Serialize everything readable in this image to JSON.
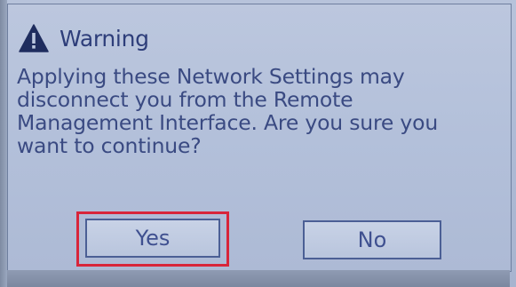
{
  "dialog": {
    "icon": "warning-triangle-icon",
    "title": "Warning",
    "message": "Applying these Network Settings may disconnect you from the Remote Management Interface. Are you sure you want to continue?",
    "message_lines": [
      "Applying these Network Settings may",
      "disconnect you from the Remote",
      "Management Interface. Are you sure you",
      "want to continue?"
    ]
  },
  "buttons": {
    "yes_label": "Yes",
    "no_label": "No"
  },
  "colors": {
    "text": "#3a4a82",
    "background": "#b3c0da",
    "highlight": "#d8253a"
  }
}
